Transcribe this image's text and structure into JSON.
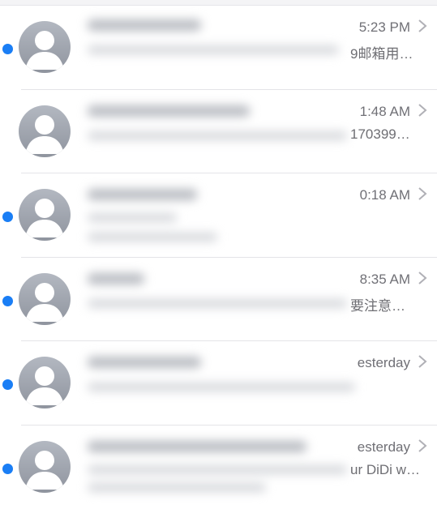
{
  "messages": [
    {
      "unread": true,
      "time": "5:23 PM",
      "preview": "9邮箱用…"
    },
    {
      "unread": false,
      "time": "1:48 AM",
      "preview": "170399…"
    },
    {
      "unread": true,
      "time": "0:18 AM",
      "preview": ""
    },
    {
      "unread": true,
      "time": "8:35 AM",
      "preview": "要注意…"
    },
    {
      "unread": true,
      "time": "esterday",
      "preview": ""
    },
    {
      "unread": true,
      "time": "esterday",
      "preview": "ur DiDi w…"
    }
  ],
  "colors": {
    "unread_dot": "#1a7ef5",
    "separator": "#e4e4e8",
    "secondary_text": "#707076"
  },
  "icons": {
    "avatar": "person-silhouette-icon",
    "disclosure": "chevron-right-icon"
  }
}
